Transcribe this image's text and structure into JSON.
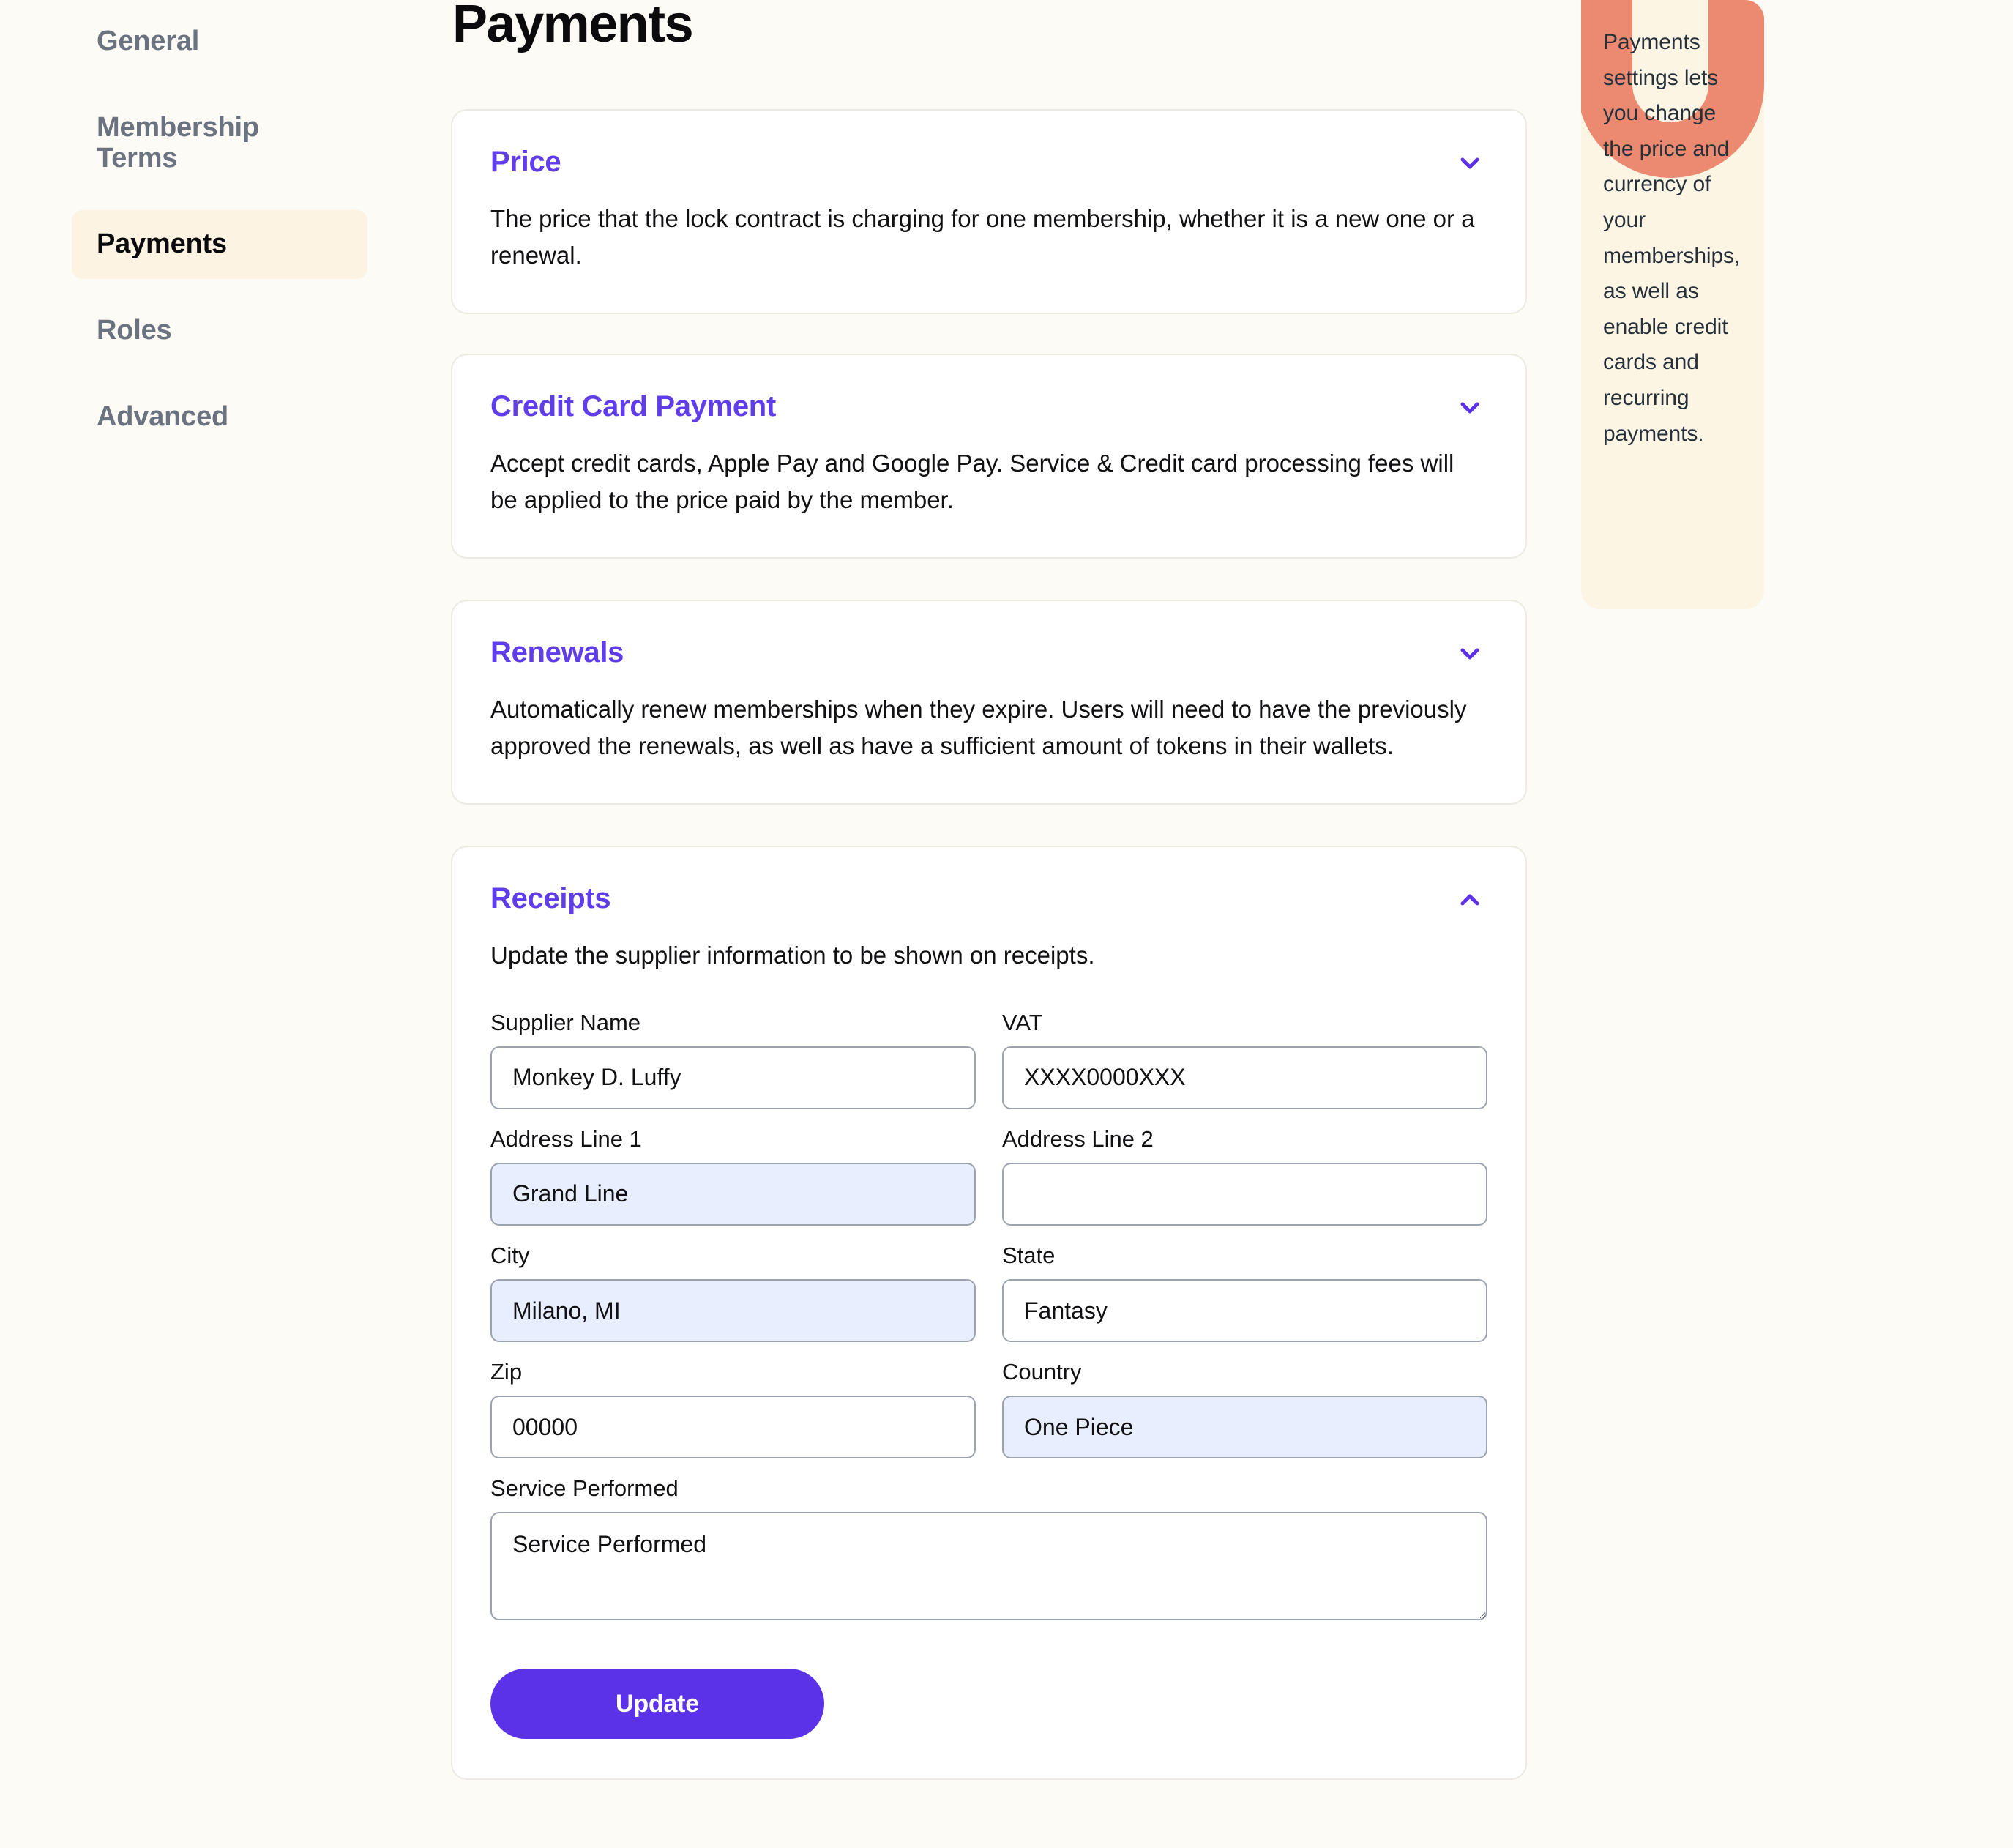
{
  "colors": {
    "page_bg": "#FDFBF6",
    "accent_purple": "#603DEB",
    "button_purple": "#5B32E8",
    "active_nav_bg": "#FDF3E2",
    "info_panel_bg": "#FDF5E4",
    "decoration_salmon": "#EC8A71",
    "autofill_blue": "#E8EEFD",
    "nav_inactive_text": "#6B7280",
    "card_border": "#EDEAE4",
    "input_border": "#9CA3AF"
  },
  "sidebar": {
    "items": [
      {
        "label": "General",
        "active": false
      },
      {
        "label": "Membership Terms",
        "active": false
      },
      {
        "label": "Payments",
        "active": true
      },
      {
        "label": "Roles",
        "active": false
      },
      {
        "label": "Advanced",
        "active": false
      }
    ]
  },
  "header": {
    "title": "Payments"
  },
  "cards": {
    "price": {
      "title": "Price",
      "description": "The price that the lock contract is charging for one membership, whether it is a new one or a renewal.",
      "chevron": "chevron-down-icon",
      "expanded": false
    },
    "credit_card": {
      "title": "Credit Card Payment",
      "description": "Accept credit cards, Apple Pay and Google Pay. Service & Credit card processing fees will be applied to the price paid by the member.",
      "chevron": "chevron-down-icon",
      "expanded": false
    },
    "renewals": {
      "title": "Renewals",
      "description": "Automatically renew memberships when they expire. Users will need to have the previously approved the renewals, as well as have a sufficient amount of tokens in their wallets.",
      "chevron": "chevron-down-icon",
      "expanded": false
    },
    "receipts": {
      "title": "Receipts",
      "description": "Update the supplier information to be shown on receipts.",
      "chevron": "chevron-up-icon",
      "expanded": true
    }
  },
  "receipts_form": {
    "supplier_name": {
      "label": "Supplier Name",
      "value": "Monkey D. Luffy",
      "placeholder": "Supplier Name",
      "autofilled": false
    },
    "vat": {
      "label": "VAT",
      "value": "XXXX0000XXX",
      "placeholder": "VAT",
      "autofilled": false
    },
    "address_line_1": {
      "label": "Address Line 1",
      "value": "Grand Line",
      "placeholder": "Address Line 1",
      "autofilled": true
    },
    "address_line_2": {
      "label": "Address Line 2",
      "value": "",
      "placeholder": "",
      "autofilled": false
    },
    "city": {
      "label": "City",
      "value": "Milano, MI",
      "placeholder": "City",
      "autofilled": true
    },
    "state": {
      "label": "State",
      "value": "Fantasy",
      "placeholder": "State",
      "autofilled": false
    },
    "zip": {
      "label": "Zip",
      "value": "00000",
      "placeholder": "Zip",
      "autofilled": false
    },
    "country": {
      "label": "Country",
      "value": "One Piece",
      "placeholder": "Country",
      "autofilled": true
    },
    "service_performed": {
      "label": "Service Performed",
      "value": "Service Performed",
      "placeholder": "Service Performed"
    },
    "submit_label": "Update"
  },
  "info_panel": {
    "text": "Payments settings lets you change the price and currency of your memberships, as well as enable credit cards and recurring payments.",
    "decoration": "unlock-u-logo-shape"
  }
}
